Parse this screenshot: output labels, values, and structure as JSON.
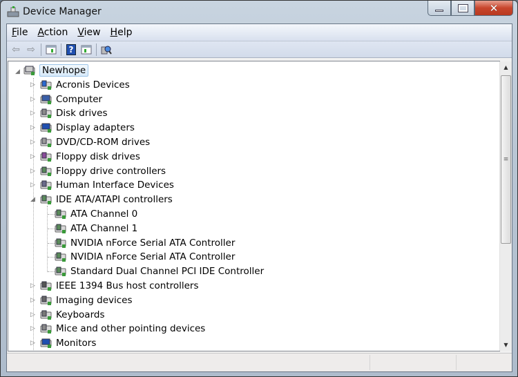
{
  "window": {
    "title": "Device Manager",
    "controls": [
      "minimize",
      "maximize",
      "close"
    ]
  },
  "menu": [
    "File",
    "Action",
    "View",
    "Help"
  ],
  "toolbar": [
    {
      "icon": "back-arrow-icon"
    },
    {
      "icon": "forward-arrow-icon"
    },
    {
      "icon": "show-hide-console-tree-icon"
    },
    {
      "icon": "help-icon"
    },
    {
      "icon": "show-action-pane-icon"
    },
    {
      "icon": "scan-hardware-icon"
    }
  ],
  "tree": {
    "root": "Newhope",
    "items": [
      {
        "label": "Acronis Devices",
        "expanded": false,
        "icon": "network-icon",
        "color": "#2a6ad0"
      },
      {
        "label": "Computer",
        "expanded": false,
        "icon": "computer-icon",
        "color": "#3a5fa8"
      },
      {
        "label": "Disk drives",
        "expanded": false,
        "icon": "disk-drive-icon",
        "color": "#8a8a8a"
      },
      {
        "label": "Display adapters",
        "expanded": false,
        "icon": "display-adapter-icon",
        "color": "#1f4fb0"
      },
      {
        "label": "DVD/CD-ROM drives",
        "expanded": false,
        "icon": "dvd-drive-icon",
        "color": "#9a9a9a"
      },
      {
        "label": "Floppy disk drives",
        "expanded": false,
        "icon": "floppy-disk-icon",
        "color": "#8a4a9a"
      },
      {
        "label": "Floppy drive controllers",
        "expanded": false,
        "icon": "controller-icon",
        "color": "#5a8a5a"
      },
      {
        "label": "Human Interface Devices",
        "expanded": false,
        "icon": "hid-icon",
        "color": "#6a6a8a"
      },
      {
        "label": "IDE ATA/ATAPI controllers",
        "expanded": true,
        "icon": "ide-controller-icon",
        "color": "#5a8a5a",
        "children": [
          "ATA Channel 0",
          "ATA Channel 1",
          "NVIDIA nForce Serial ATA Controller",
          "NVIDIA nForce Serial ATA Controller",
          "Standard Dual Channel PCI IDE Controller"
        ]
      },
      {
        "label": "IEEE 1394 Bus host controllers",
        "expanded": false,
        "icon": "firewire-icon",
        "color": "#555555"
      },
      {
        "label": "Imaging devices",
        "expanded": false,
        "icon": "camera-icon",
        "color": "#666666"
      },
      {
        "label": "Keyboards",
        "expanded": false,
        "icon": "keyboard-icon",
        "color": "#777777"
      },
      {
        "label": "Mice and other pointing devices",
        "expanded": false,
        "icon": "mouse-icon",
        "color": "#888888"
      },
      {
        "label": "Monitors",
        "expanded": false,
        "icon": "monitor-icon",
        "color": "#1f4fb0"
      }
    ]
  }
}
